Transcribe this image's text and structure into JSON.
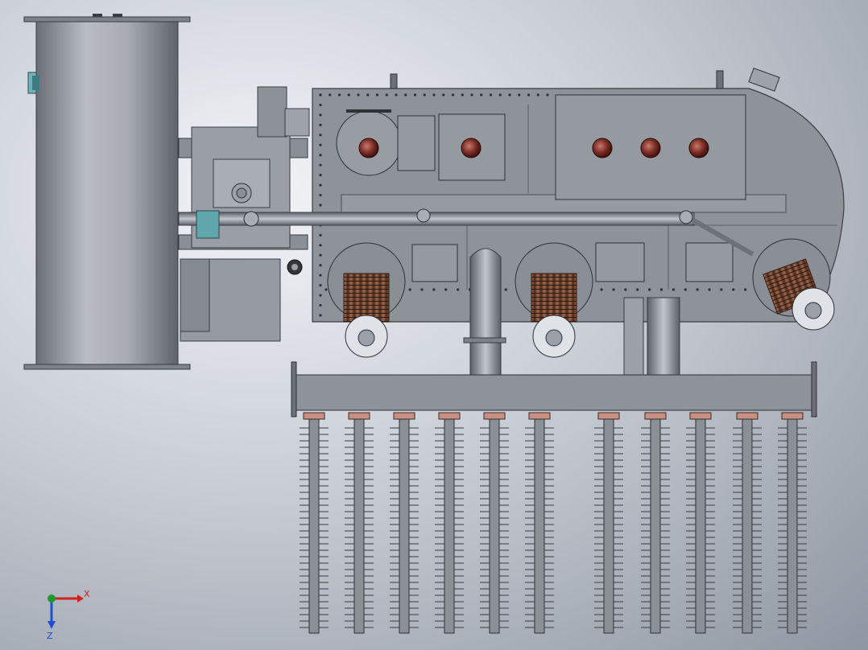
{
  "colors": {
    "steel_light": "#b8bcc2",
    "steel_mid": "#8e939a",
    "steel_dark": "#5a5f66",
    "tank_fill": "#8a8f96",
    "bushing_red": "#7a2b24",
    "winding_brown": "#7b4a33",
    "axis_x": "#d22020",
    "axis_y": "#1f9a2a",
    "axis_z": "#2050d0"
  },
  "icons": {
    "triad": "coordinate-triad-icon"
  },
  "triad": {
    "x_label": "X",
    "z_label": "Z"
  }
}
